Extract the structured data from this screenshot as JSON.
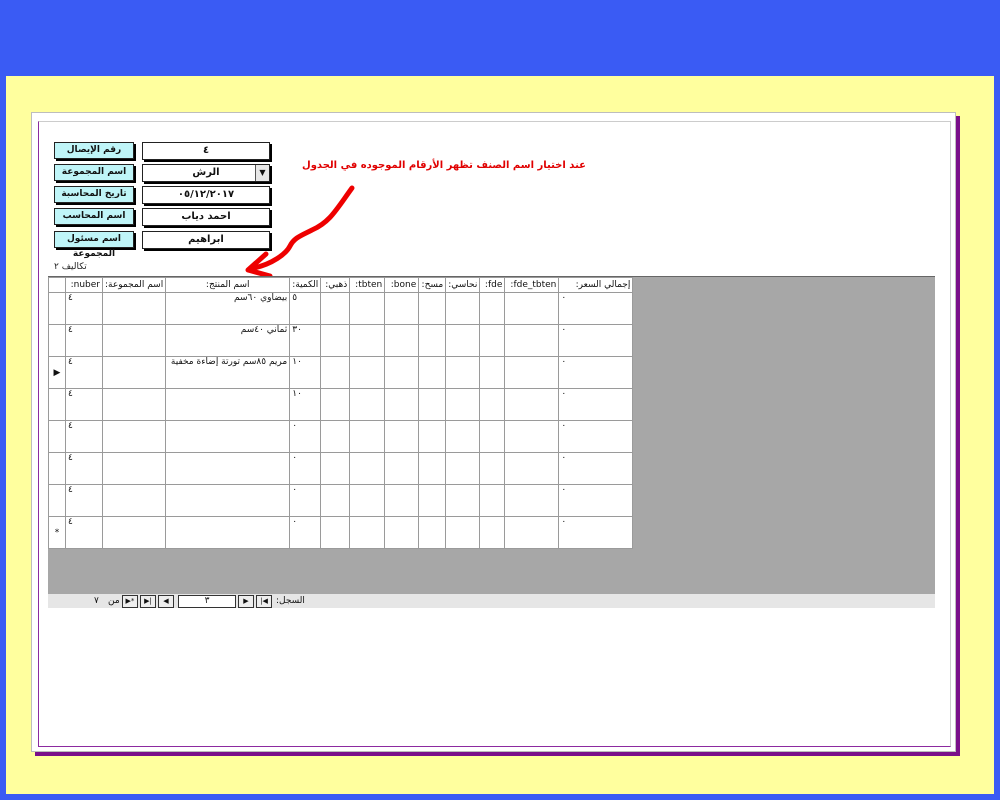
{
  "form": {
    "fields": [
      {
        "label": "رقم الإيصال",
        "value": "٤"
      },
      {
        "label": "اسم المجموعة",
        "value": "الرش"
      },
      {
        "label": "تاريخ المحاسبة",
        "value": "٠٥/١٢/٢٠١٧"
      },
      {
        "label": "اسم المحاسب",
        "value": "احمد دياب"
      },
      {
        "label": "اسم مسئول المجموعة",
        "value": "ابراهيم"
      }
    ]
  },
  "annotation": "عند اختيار اسم الصنف تظهر الأرقام الموجوده في الجدول",
  "subform_caption": "تكاليف ٢",
  "table": {
    "columns": [
      "nuber:",
      "اسم المجموعة:",
      "اسم المنتج:",
      "الكمية:",
      "ذهبي:",
      "tbten:",
      "bone:",
      "مسح:",
      "نحاسي:",
      "fde:",
      "fde_tbten:",
      "إجمالي السعر:"
    ],
    "rows": [
      {
        "sel": "",
        "nuber": "٤",
        "group": "",
        "product": "بيضاوي ٦٠سم",
        "qty": "٥",
        "total": "٠"
      },
      {
        "sel": "",
        "nuber": "٤",
        "group": "",
        "product": "ثماني ٤٠سم",
        "qty": "٣٠",
        "total": "٠"
      },
      {
        "sel": "▶",
        "nuber": "٤",
        "group": "",
        "product": "مريم ٨٥سم تورتة إضاءة مخفية",
        "qty": "١٠",
        "total": "٠"
      },
      {
        "sel": "",
        "nuber": "٤",
        "group": "",
        "product": "",
        "qty": "١٠",
        "total": "٠"
      },
      {
        "sel": "",
        "nuber": "٤",
        "group": "",
        "product": "",
        "qty": "٠",
        "total": "٠"
      },
      {
        "sel": "",
        "nuber": "٤",
        "group": "",
        "product": "",
        "qty": "٠",
        "total": "٠"
      },
      {
        "sel": "",
        "nuber": "٤",
        "group": "",
        "product": "",
        "qty": "٠",
        "total": "٠"
      },
      {
        "sel": "*",
        "nuber": "٤",
        "group": "",
        "product": "",
        "qty": "٠",
        "total": "٠"
      }
    ]
  },
  "nav": {
    "record_label": "السجل:",
    "current": "٣",
    "of_label": "من",
    "total": "٧"
  }
}
